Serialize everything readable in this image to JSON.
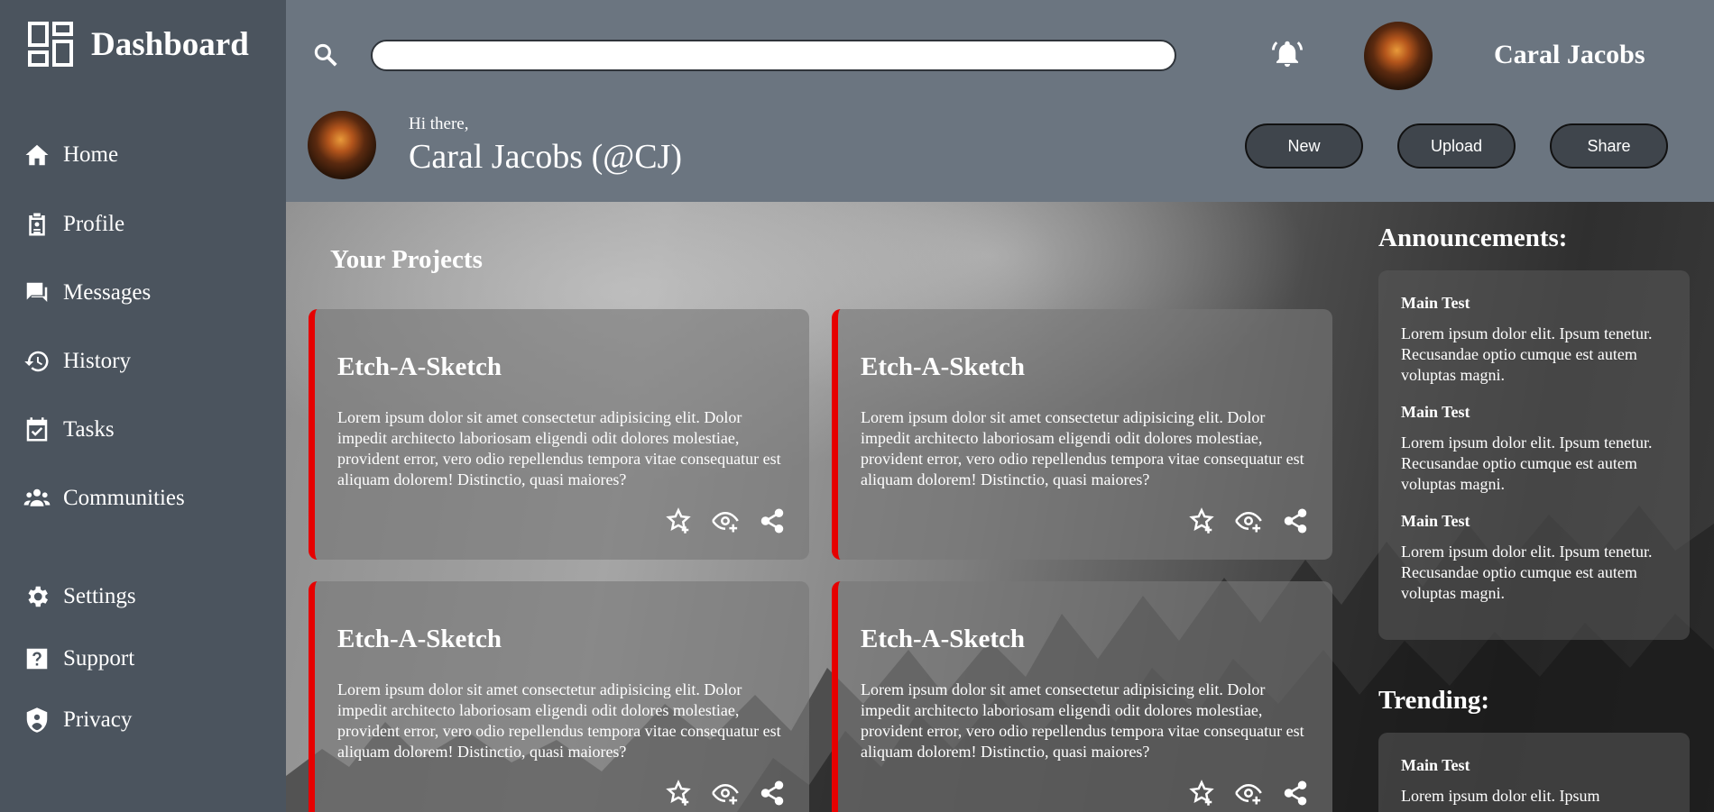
{
  "brand": {
    "title": "Dashboard"
  },
  "nav": {
    "items": [
      {
        "label": "Home",
        "icon": "home-icon"
      },
      {
        "label": "Profile",
        "icon": "id-badge-icon"
      },
      {
        "label": "Messages",
        "icon": "chat-icon"
      },
      {
        "label": "History",
        "icon": "history-icon"
      },
      {
        "label": "Tasks",
        "icon": "calendar-check-icon"
      },
      {
        "label": "Communities",
        "icon": "group-icon"
      },
      {
        "label": "Settings",
        "icon": "gear-icon"
      },
      {
        "label": "Support",
        "icon": "help-icon"
      },
      {
        "label": "Privacy",
        "icon": "shield-user-icon"
      }
    ]
  },
  "header": {
    "search": {
      "value": "",
      "placeholder": ""
    },
    "user_name": "Caral Jacobs",
    "greeting": "Hi there,",
    "greeting_name": "Caral Jacobs (@CJ)",
    "buttons": {
      "new": "New",
      "upload": "Upload",
      "share": "Share"
    }
  },
  "projects": {
    "title": "Your Projects",
    "cards": [
      {
        "title": "Etch-A-Sketch",
        "body": "Lorem ipsum dolor sit amet consectetur adipisicing elit. Dolor impedit architecto laboriosam eligendi odit dolores molestiae, provident error, vero odio repellendus tempora vitae consequatur est aliquam dolorem! Distinctio, quasi maiores?"
      },
      {
        "title": "Etch-A-Sketch",
        "body": "Lorem ipsum dolor sit amet consectetur adipisicing elit. Dolor impedit architecto laboriosam eligendi odit dolores molestiae, provident error, vero odio repellendus tempora vitae consequatur est aliquam dolorem! Distinctio, quasi maiores?"
      },
      {
        "title": "Etch-A-Sketch",
        "body": "Lorem ipsum dolor sit amet consectetur adipisicing elit. Dolor impedit architecto laboriosam eligendi odit dolores molestiae, provident error, vero odio repellendus tempora vitae consequatur est aliquam dolorem! Distinctio, quasi maiores?"
      },
      {
        "title": "Etch-A-Sketch",
        "body": "Lorem ipsum dolor sit amet consectetur adipisicing elit. Dolor impedit architecto laboriosam eligendi odit dolores molestiae, provident error, vero odio repellendus tempora vitae consequatur est aliquam dolorem! Distinctio, quasi maiores?"
      }
    ]
  },
  "announcements": {
    "title": "Announcements:",
    "items": [
      {
        "title": "Main Test",
        "body": "Lorem ipsum dolor elit. Ipsum tenetur. Recusandae optio cumque est autem voluptas magni."
      },
      {
        "title": "Main Test",
        "body": "Lorem ipsum dolor elit. Ipsum tenetur. Recusandae optio cumque est autem voluptas magni."
      },
      {
        "title": "Main Test",
        "body": "Lorem ipsum dolor elit. Ipsum tenetur. Recusandae optio cumque est autem voluptas magni."
      }
    ]
  },
  "trending": {
    "title": "Trending:",
    "items": [
      {
        "title": "Main Test",
        "body": "Lorem ipsum dolor elit. Ipsum"
      }
    ]
  },
  "colors": {
    "sidebar": "#4b545e",
    "header": "#6b7580",
    "card_accent": "#e60000",
    "button": "#3f454c"
  }
}
